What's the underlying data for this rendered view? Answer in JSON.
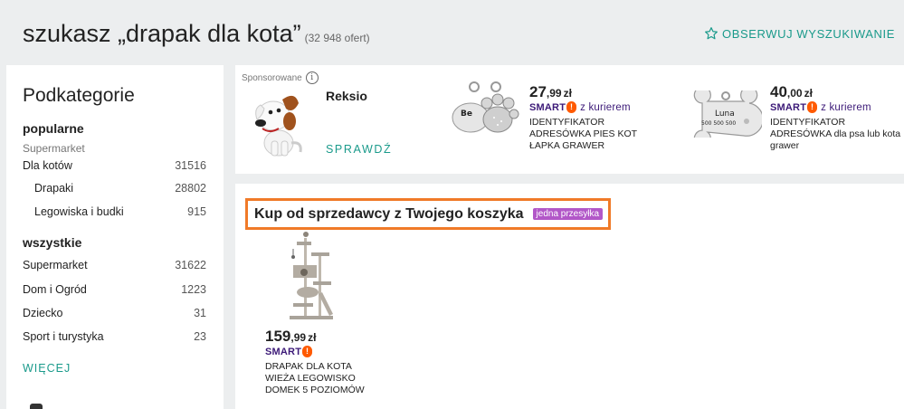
{
  "header": {
    "title": "szukasz „drapak dla kota”",
    "count": "(32 948 ofert)",
    "follow_label": "OBSERWUJ WYSZUKIWANIE"
  },
  "sidebar": {
    "title": "Podkategorie",
    "popular_heading": "popularne",
    "popular_subheading": "Supermarket",
    "popular_items": [
      {
        "label": "Dla kotów",
        "count": "31516"
      },
      {
        "label": "Drapaki",
        "count": "28802"
      },
      {
        "label": "Legowiska i budki",
        "count": "915"
      }
    ],
    "all_heading": "wszystkie",
    "all_items": [
      {
        "label": "Supermarket",
        "count": "31622"
      },
      {
        "label": "Dom i Ogród",
        "count": "1223"
      },
      {
        "label": "Dziecko",
        "count": "31"
      },
      {
        "label": "Sport i turystyka",
        "count": "23"
      }
    ],
    "more_label": "WIĘCEJ"
  },
  "sponsored": {
    "label": "Sponsorowane",
    "info_icon": "i",
    "brand_name": "Reksio",
    "cta_label": "SPRAWDŹ",
    "offers": [
      {
        "price_main": "27",
        "price_cents": ",99",
        "currency": "zł",
        "smart": "SMART",
        "bang": "!",
        "courier": "z kurierem",
        "title": "IDENTYFIKATOR ADRESÓWKA PIES KOT ŁAPKA GRAWER",
        "tag_text": "Be"
      },
      {
        "price_main": "40",
        "price_cents": ",00",
        "currency": "zł",
        "smart": "SMART",
        "bang": "!",
        "courier": "z kurierem",
        "title": "IDENTYFIKATOR ADRESÓWKA dla psa lub kota grawer",
        "tag_name": "Luna",
        "tag_phone": "500 500 500"
      }
    ]
  },
  "seller": {
    "title": "Kup od sprzedawcy z Twojego koszyka",
    "badge": "jedna przesyłka",
    "offer": {
      "price_main": "159",
      "price_cents": ",99",
      "currency": "zł",
      "smart": "SMART",
      "bang": "!",
      "title": "DRAPAK DLA KOTA WIEŻA LEGOWISKO DOMEK 5 POZIOMÓW"
    }
  },
  "colors": {
    "accent": "#1a9a8b",
    "smart": "#3c1a78",
    "smart_bang": "#ff5a00",
    "highlight_border": "#f07a28",
    "badge": "#b257c8"
  }
}
